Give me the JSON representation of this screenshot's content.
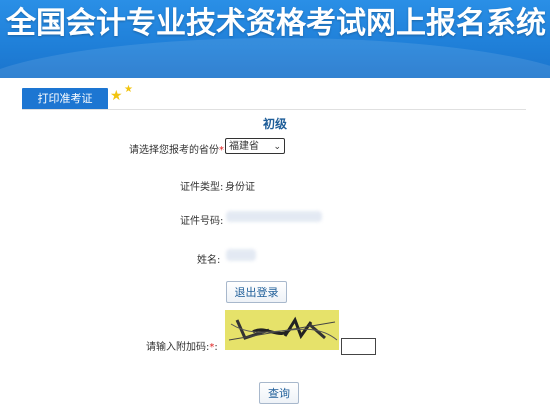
{
  "header": {
    "title": "全国会计专业技术资格考试网上报名系统"
  },
  "tabs": [
    {
      "label": "打印准考证"
    }
  ],
  "exam_level": "初级",
  "form": {
    "province_label": "请选择您报考的省份",
    "province_value": "福建省",
    "id_type_label": "证件类型:",
    "id_type_value": "身份证",
    "id_number_label": "证件号码:",
    "name_label": "姓名:",
    "captcha_label": "请输入附加码:",
    "required_mark": "*",
    "colon": ":"
  },
  "buttons": {
    "logout": "退出登录",
    "query": "查询"
  },
  "colors": {
    "banner": "#1f7fd8",
    "tab": "#1d76d2",
    "required": "#e02020"
  }
}
